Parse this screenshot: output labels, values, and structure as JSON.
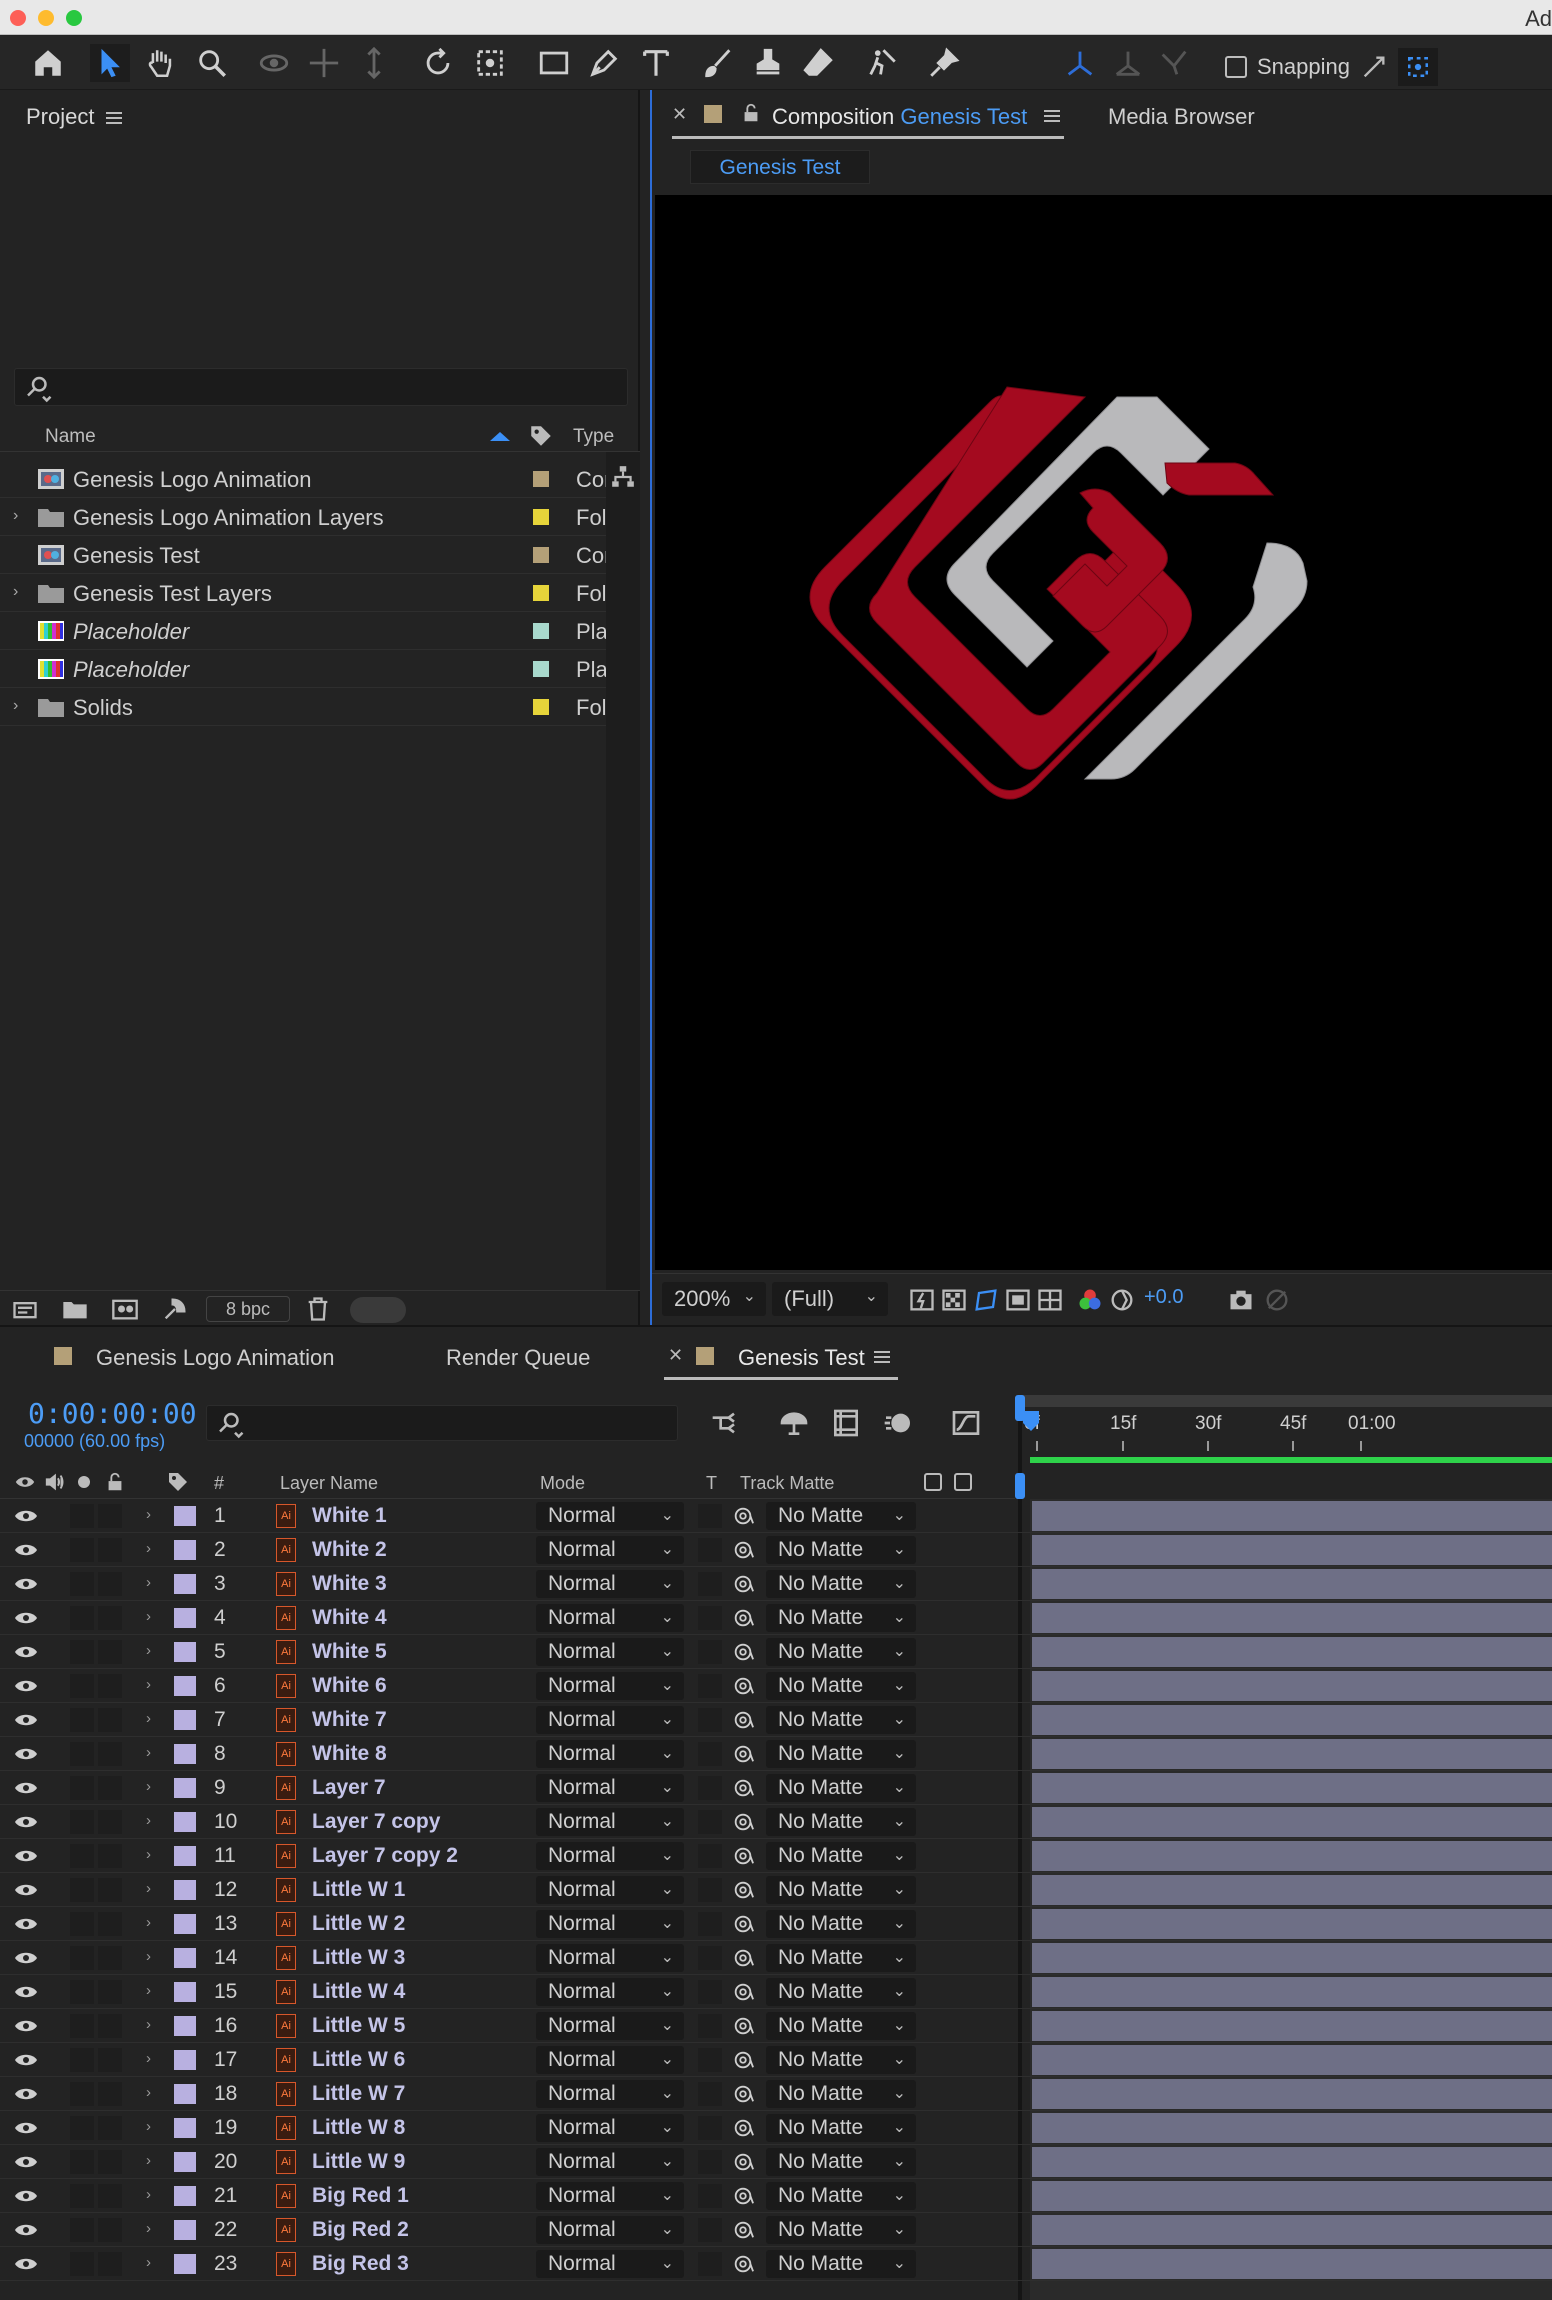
{
  "app": {
    "title_fragment": "Ad"
  },
  "toolbar": {
    "snapping_label": "Snapping"
  },
  "project": {
    "tab_label": "Project",
    "columns": {
      "name": "Name",
      "type": "Type"
    },
    "items": [
      {
        "name": "Genesis Logo Animation",
        "type": "Com",
        "italic": false,
        "kind": "comp",
        "expandable": false,
        "color": "#b4a078"
      },
      {
        "name": "Genesis Logo Animation Layers",
        "type": "Fol",
        "italic": false,
        "kind": "folder",
        "expandable": true,
        "color": "#e6d43a"
      },
      {
        "name": "Genesis Test",
        "type": "Com",
        "italic": false,
        "kind": "comp",
        "expandable": false,
        "color": "#b4a078"
      },
      {
        "name": "Genesis Test Layers",
        "type": "Fol",
        "italic": false,
        "kind": "folder",
        "expandable": true,
        "color": "#e6d43a"
      },
      {
        "name": "Placeholder",
        "type": "Pla",
        "italic": true,
        "kind": "placeholder",
        "expandable": false,
        "color": "#a8d8cc"
      },
      {
        "name": "Placeholder",
        "type": "Pla",
        "italic": true,
        "kind": "placeholder",
        "expandable": false,
        "color": "#a8d8cc"
      },
      {
        "name": "Solids",
        "type": "Fol",
        "italic": false,
        "kind": "folder",
        "expandable": true,
        "color": "#e6d43a"
      }
    ],
    "bpc_label": "8 bpc"
  },
  "composition": {
    "tab_prefix": "Composition",
    "tab_name": "Genesis Test",
    "other_tab": "Media Browser",
    "subtab": "Genesis Test",
    "zoom": "200%",
    "resolution": "(Full)",
    "exposure": "+0.0"
  },
  "timeline": {
    "tabs": [
      {
        "label": "Genesis Logo Animation"
      },
      {
        "label": "Render Queue"
      },
      {
        "label": "Genesis Test"
      }
    ],
    "timecode": "0:00:00:00",
    "frame_fps": "00000 (60.00 fps)",
    "ruler_ticks": [
      "0f",
      "15f",
      "30f",
      "45f",
      "01:00"
    ],
    "columns": {
      "num": "#",
      "layer_name": "Layer Name",
      "mode": "Mode",
      "t": "T",
      "track_matte": "Track Matte"
    },
    "layers": [
      {
        "num": "1",
        "name": "White 1",
        "mode": "Normal",
        "matte": "No Matte"
      },
      {
        "num": "2",
        "name": "White 2",
        "mode": "Normal",
        "matte": "No Matte"
      },
      {
        "num": "3",
        "name": "White 3",
        "mode": "Normal",
        "matte": "No Matte"
      },
      {
        "num": "4",
        "name": "White 4",
        "mode": "Normal",
        "matte": "No Matte"
      },
      {
        "num": "5",
        "name": "White 5",
        "mode": "Normal",
        "matte": "No Matte"
      },
      {
        "num": "6",
        "name": "White 6",
        "mode": "Normal",
        "matte": "No Matte"
      },
      {
        "num": "7",
        "name": "White 7",
        "mode": "Normal",
        "matte": "No Matte"
      },
      {
        "num": "8",
        "name": "White 8",
        "mode": "Normal",
        "matte": "No Matte"
      },
      {
        "num": "9",
        "name": "Layer 7",
        "mode": "Normal",
        "matte": "No Matte"
      },
      {
        "num": "10",
        "name": "Layer 7 copy",
        "mode": "Normal",
        "matte": "No Matte"
      },
      {
        "num": "11",
        "name": "Layer 7 copy 2",
        "mode": "Normal",
        "matte": "No Matte"
      },
      {
        "num": "12",
        "name": "Little W 1",
        "mode": "Normal",
        "matte": "No Matte"
      },
      {
        "num": "13",
        "name": "Little W 2",
        "mode": "Normal",
        "matte": "No Matte"
      },
      {
        "num": "14",
        "name": "Little W 3",
        "mode": "Normal",
        "matte": "No Matte"
      },
      {
        "num": "15",
        "name": "Little W 4",
        "mode": "Normal",
        "matte": "No Matte"
      },
      {
        "num": "16",
        "name": "Little W 5",
        "mode": "Normal",
        "matte": "No Matte"
      },
      {
        "num": "17",
        "name": "Little W 6",
        "mode": "Normal",
        "matte": "No Matte"
      },
      {
        "num": "18",
        "name": "Little W 7",
        "mode": "Normal",
        "matte": "No Matte"
      },
      {
        "num": "19",
        "name": "Little W 8",
        "mode": "Normal",
        "matte": "No Matte"
      },
      {
        "num": "20",
        "name": "Little W 9",
        "mode": "Normal",
        "matte": "No Matte"
      },
      {
        "num": "21",
        "name": "Big Red 1",
        "mode": "Normal",
        "matte": "No Matte"
      },
      {
        "num": "22",
        "name": "Big Red 2",
        "mode": "Normal",
        "matte": "No Matte"
      },
      {
        "num": "23",
        "name": "Big Red 3",
        "mode": "Normal",
        "matte": "No Matte"
      }
    ]
  },
  "colors": {
    "accent": "#4c9cf5",
    "logo_red": "#a40a1f",
    "logo_gray": "#b9b9bb",
    "layer_label": "#b8b0e0",
    "track_bar": "#6e6f86"
  }
}
